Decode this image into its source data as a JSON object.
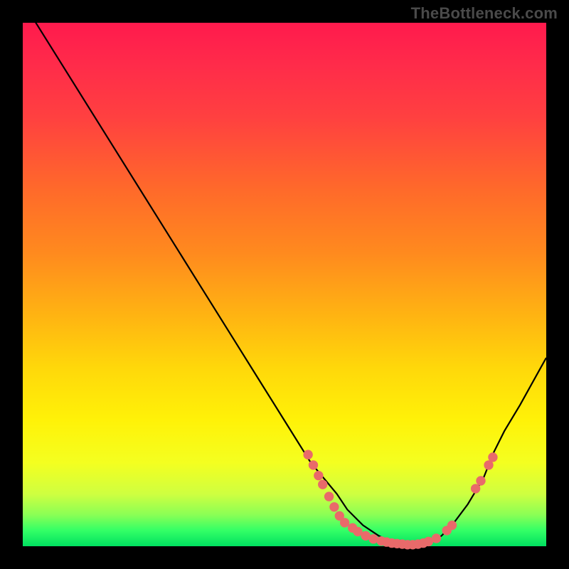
{
  "watermark": "TheBottleneck.com",
  "colors": {
    "curve_stroke": "#000000",
    "marker_fill": "#e96a6a",
    "marker_stroke": "#e96a6a"
  },
  "chart_data": {
    "type": "line",
    "title": "",
    "xlabel": "",
    "ylabel": "",
    "xlim": [
      0,
      100
    ],
    "ylim": [
      0,
      100
    ],
    "grid": false,
    "series": [
      {
        "name": "curve",
        "x": [
          0,
          5,
          10,
          15,
          20,
          25,
          30,
          35,
          40,
          45,
          50,
          55,
          60,
          62,
          65,
          68,
          70,
          72,
          75,
          78,
          80,
          82,
          85,
          88,
          90,
          92,
          95,
          100
        ],
        "values": [
          104,
          96,
          88,
          80,
          72,
          64,
          56,
          48,
          40,
          32,
          24,
          16,
          10,
          7,
          4,
          2,
          1,
          0.5,
          0.3,
          0.8,
          2,
          4,
          8,
          13,
          18,
          22,
          27,
          36
        ]
      }
    ],
    "markers": [
      {
        "x": 54.5,
        "y": 17.5
      },
      {
        "x": 55.5,
        "y": 15.5
      },
      {
        "x": 56.5,
        "y": 13.5
      },
      {
        "x": 57.3,
        "y": 11.8
      },
      {
        "x": 58.5,
        "y": 9.5
      },
      {
        "x": 59.5,
        "y": 7.5
      },
      {
        "x": 60.5,
        "y": 5.8
      },
      {
        "x": 61.5,
        "y": 4.5
      },
      {
        "x": 63.0,
        "y": 3.5
      },
      {
        "x": 64.0,
        "y": 2.8
      },
      {
        "x": 65.5,
        "y": 2.0
      },
      {
        "x": 67.0,
        "y": 1.4
      },
      {
        "x": 68.5,
        "y": 1.0
      },
      {
        "x": 69.5,
        "y": 0.8
      },
      {
        "x": 70.5,
        "y": 0.6
      },
      {
        "x": 71.5,
        "y": 0.5
      },
      {
        "x": 72.5,
        "y": 0.4
      },
      {
        "x": 73.5,
        "y": 0.3
      },
      {
        "x": 74.5,
        "y": 0.3
      },
      {
        "x": 75.5,
        "y": 0.4
      },
      {
        "x": 76.5,
        "y": 0.6
      },
      {
        "x": 77.5,
        "y": 0.9
      },
      {
        "x": 79.0,
        "y": 1.5
      },
      {
        "x": 81.0,
        "y": 3.0
      },
      {
        "x": 82.0,
        "y": 4.0
      },
      {
        "x": 86.5,
        "y": 11.0
      },
      {
        "x": 87.5,
        "y": 12.5
      },
      {
        "x": 89.0,
        "y": 15.5
      },
      {
        "x": 89.8,
        "y": 17.0
      }
    ]
  }
}
